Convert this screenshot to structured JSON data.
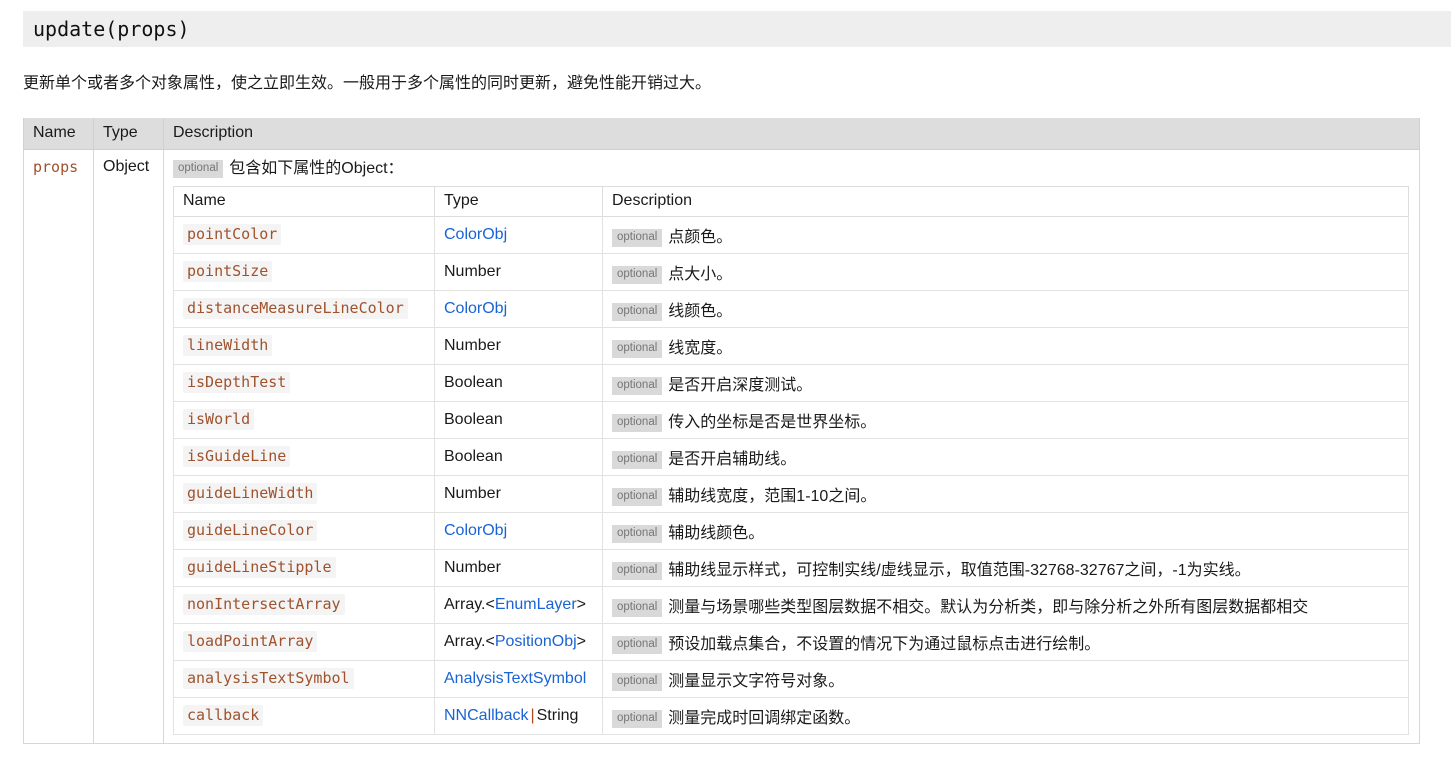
{
  "method": {
    "title": "update(props)",
    "description": "更新单个或者多个对象属性，使之立即生效。一般用于多个属性的同时更新，避免性能开销过大。"
  },
  "outer_table": {
    "headers": {
      "name": "Name",
      "type": "Type",
      "description": "Description"
    },
    "row": {
      "name": "props",
      "type": "Object",
      "badge": "optional",
      "intro": "包含如下属性的Object："
    }
  },
  "inner_table": {
    "headers": {
      "name": "Name",
      "type": "Type",
      "description": "Description"
    },
    "badge": "optional",
    "rows": [
      {
        "name": "pointColor",
        "type_pre": "",
        "type_link": "ColorObj",
        "type_post": "",
        "type_sep": "",
        "type_tail": "",
        "desc": "点颜色。"
      },
      {
        "name": "pointSize",
        "type_pre": "Number",
        "type_link": "",
        "type_post": "",
        "type_sep": "",
        "type_tail": "",
        "desc": "点大小。"
      },
      {
        "name": "distanceMeasureLineColor",
        "type_pre": "",
        "type_link": "ColorObj",
        "type_post": "",
        "type_sep": "",
        "type_tail": "",
        "desc": "线颜色。"
      },
      {
        "name": "lineWidth",
        "type_pre": "Number",
        "type_link": "",
        "type_post": "",
        "type_sep": "",
        "type_tail": "",
        "desc": "线宽度。"
      },
      {
        "name": "isDepthTest",
        "type_pre": "Boolean",
        "type_link": "",
        "type_post": "",
        "type_sep": "",
        "type_tail": "",
        "desc": "是否开启深度测试。"
      },
      {
        "name": "isWorld",
        "type_pre": "Boolean",
        "type_link": "",
        "type_post": "",
        "type_sep": "",
        "type_tail": "",
        "desc": "传入的坐标是否是世界坐标。"
      },
      {
        "name": "isGuideLine",
        "type_pre": "Boolean",
        "type_link": "",
        "type_post": "",
        "type_sep": "",
        "type_tail": "",
        "desc": "是否开启辅助线。"
      },
      {
        "name": "guideLineWidth",
        "type_pre": "Number",
        "type_link": "",
        "type_post": "",
        "type_sep": "",
        "type_tail": "",
        "desc": "辅助线宽度，范围1-10之间。"
      },
      {
        "name": "guideLineColor",
        "type_pre": "",
        "type_link": "ColorObj",
        "type_post": "",
        "type_sep": "",
        "type_tail": "",
        "desc": "辅助线颜色。"
      },
      {
        "name": "guideLineStipple",
        "type_pre": "Number",
        "type_link": "",
        "type_post": "",
        "type_sep": "",
        "type_tail": "",
        "desc": "辅助线显示样式，可控制实线/虚线显示，取值范围-32768-32767之间，-1为实线。"
      },
      {
        "name": "nonIntersectArray",
        "type_pre": "Array.<",
        "type_link": "EnumLayer",
        "type_post": ">",
        "type_sep": "",
        "type_tail": "",
        "desc": "测量与场景哪些类型图层数据不相交。默认为分析类，即与除分析之外所有图层数据都相交"
      },
      {
        "name": "loadPointArray",
        "type_pre": "Array.<",
        "type_link": "PositionObj",
        "type_post": ">",
        "type_sep": "",
        "type_tail": "",
        "desc": "预设加载点集合，不设置的情况下为通过鼠标点击进行绘制。"
      },
      {
        "name": "analysisTextSymbol",
        "type_pre": "",
        "type_link": "AnalysisTextSymbol",
        "type_post": "",
        "type_sep": "",
        "type_tail": "",
        "desc": "测量显示文字符号对象。"
      },
      {
        "name": "callback",
        "type_pre": "",
        "type_link": "NNCallback",
        "type_post": "",
        "type_sep": "|",
        "type_tail": "String",
        "desc": "测量完成时回调绑定函数。"
      }
    ]
  },
  "colors": {
    "title_bar_bg": "#eeeeee",
    "header_bg": "#dddddd",
    "property_name": "#a0522d",
    "link": "#1a63d4",
    "badge_bg": "#d9d9d9",
    "badge_text": "#757575",
    "name_highlight_bg": "#f4f4f4",
    "type_separator": "#b5481a"
  }
}
